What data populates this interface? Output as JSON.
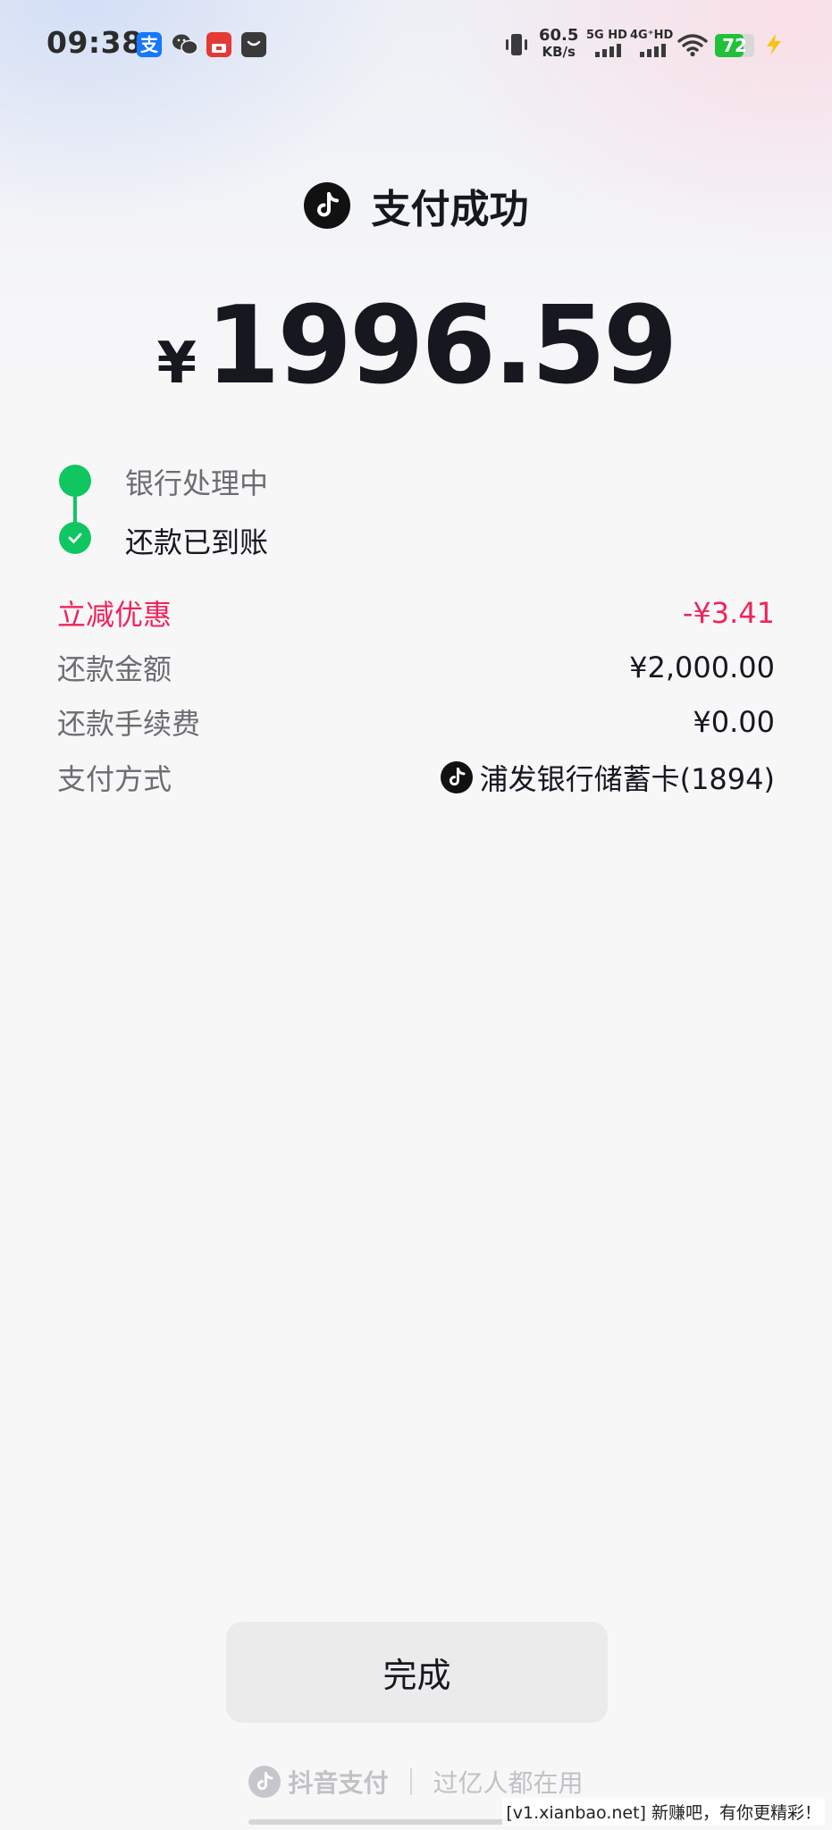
{
  "status_bar": {
    "time": "09:38",
    "net_speed_value": "60.5",
    "net_speed_unit": "KB/s",
    "sim1_label": "5G HD",
    "sim2_label": "4G⁺HD",
    "battery_level": "72",
    "battery_fraction": 0.72,
    "icons": [
      "alipay-icon",
      "wechat-icon",
      "app-red-icon",
      "app-dark-icon",
      "vibrate-icon",
      "wifi-icon",
      "battery-icon",
      "charging-icon"
    ]
  },
  "header": {
    "title": "支付成功",
    "logo_icon": "douyin-icon"
  },
  "amount": {
    "currency": "¥",
    "value": "1996.59"
  },
  "timeline": {
    "steps": [
      {
        "label": "银行处理中",
        "state": "done"
      },
      {
        "label": "还款已到账",
        "state": "current"
      }
    ]
  },
  "details": [
    {
      "label": "立减优惠",
      "value": "-¥3.41",
      "highlight": true
    },
    {
      "label": "还款金额",
      "value": "¥2,000.00"
    },
    {
      "label": "还款手续费",
      "value": "¥0.00"
    },
    {
      "label": "支付方式",
      "value": "浦发银行储蓄卡(1894)",
      "icon": "douyin-icon"
    }
  ],
  "done_button_label": "完成",
  "footer": {
    "brand": "抖音支付",
    "slogan": "过亿人都在用"
  },
  "watermark": "[v1.xianbao.net] 新赚吧，有你更精彩！",
  "colors": {
    "accent_green": "#0fc661",
    "discount_red": "#f0245a",
    "text_primary": "#16171f",
    "text_secondary": "#6c6c72"
  }
}
